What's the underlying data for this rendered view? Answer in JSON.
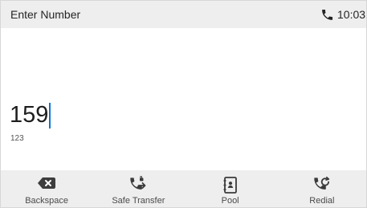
{
  "status_bar": {
    "title": "Enter Number",
    "time": "10:03",
    "icon": "phone-call-icon"
  },
  "dial_area": {
    "number": "159",
    "input_mode": "123"
  },
  "softkeys": [
    {
      "label": "Backspace",
      "icon": "backspace-icon"
    },
    {
      "label": "Safe Transfer",
      "icon": "safe-transfer-icon"
    },
    {
      "label": "Pool",
      "icon": "phonebook-pool-icon"
    },
    {
      "label": "Redial",
      "icon": "redial-icon"
    }
  ],
  "colors": {
    "accent": "#0a77d1",
    "status_background": "#eeeeee",
    "text": "#222222"
  }
}
